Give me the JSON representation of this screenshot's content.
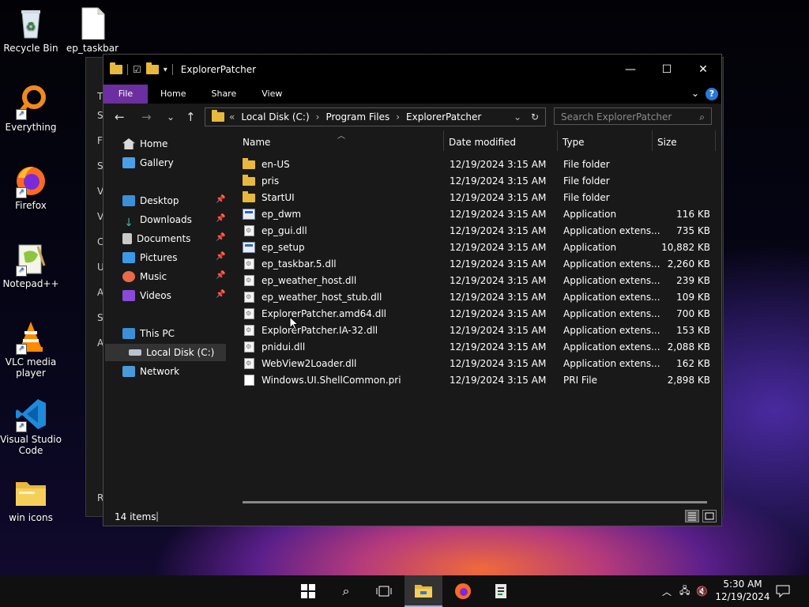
{
  "desktop": {
    "icons": [
      {
        "label": "Recycle Bin"
      },
      {
        "label": "ep_taskbar"
      },
      {
        "label": "Everything"
      },
      {
        "label": "Firefox"
      },
      {
        "label": "Notepad++"
      },
      {
        "label": "VLC media player"
      },
      {
        "label": "Visual Studio Code"
      },
      {
        "label": "win icons"
      }
    ]
  },
  "ghost_letters": [
    "T",
    "S",
    "F",
    "S",
    "V",
    "V",
    "C",
    "U",
    "A",
    "S",
    "A",
    "R"
  ],
  "window": {
    "title": "ExplorerPatcher",
    "ribbon_tabs": [
      "File",
      "Home",
      "Share",
      "View"
    ],
    "address": {
      "overflow": "«",
      "crumbs": [
        "Local Disk (C:)",
        "Program Files",
        "ExplorerPatcher"
      ]
    },
    "search_placeholder": "Search ExplorerPatcher",
    "nav": {
      "home": "Home",
      "gallery": "Gallery",
      "desktop": "Desktop",
      "downloads": "Downloads",
      "documents": "Documents",
      "pictures": "Pictures",
      "music": "Music",
      "videos": "Videos",
      "this_pc": "This PC",
      "local_disk": "Local Disk (C:)",
      "network": "Network"
    },
    "columns": {
      "name": "Name",
      "date": "Date modified",
      "type": "Type",
      "size": "Size"
    },
    "files": [
      {
        "name": "en-US",
        "date": "12/19/2024 3:15 AM",
        "type": "File folder",
        "size": "",
        "kind": "folder"
      },
      {
        "name": "pris",
        "date": "12/19/2024 3:15 AM",
        "type": "File folder",
        "size": "",
        "kind": "folder"
      },
      {
        "name": "StartUI",
        "date": "12/19/2024 3:15 AM",
        "type": "File folder",
        "size": "",
        "kind": "folder"
      },
      {
        "name": "ep_dwm",
        "date": "12/19/2024 3:15 AM",
        "type": "Application",
        "size": "116 KB",
        "kind": "app"
      },
      {
        "name": "ep_gui.dll",
        "date": "12/19/2024 3:15 AM",
        "type": "Application extens...",
        "size": "735 KB",
        "kind": "dll"
      },
      {
        "name": "ep_setup",
        "date": "12/19/2024 3:15 AM",
        "type": "Application",
        "size": "10,882 KB",
        "kind": "app"
      },
      {
        "name": "ep_taskbar.5.dll",
        "date": "12/19/2024 3:15 AM",
        "type": "Application extens...",
        "size": "2,260 KB",
        "kind": "dll"
      },
      {
        "name": "ep_weather_host.dll",
        "date": "12/19/2024 3:15 AM",
        "type": "Application extens...",
        "size": "239 KB",
        "kind": "dll"
      },
      {
        "name": "ep_weather_host_stub.dll",
        "date": "12/19/2024 3:15 AM",
        "type": "Application extens...",
        "size": "109 KB",
        "kind": "dll"
      },
      {
        "name": "ExplorerPatcher.amd64.dll",
        "date": "12/19/2024 3:15 AM",
        "type": "Application extens...",
        "size": "700 KB",
        "kind": "dll"
      },
      {
        "name": "ExplorerPatcher.IA-32.dll",
        "date": "12/19/2024 3:15 AM",
        "type": "Application extens...",
        "size": "153 KB",
        "kind": "dll"
      },
      {
        "name": "pnidui.dll",
        "date": "12/19/2024 3:15 AM",
        "type": "Application extens...",
        "size": "2,088 KB",
        "kind": "dll"
      },
      {
        "name": "WebView2Loader.dll",
        "date": "12/19/2024 3:15 AM",
        "type": "Application extens...",
        "size": "162 KB",
        "kind": "dll"
      },
      {
        "name": "Windows.UI.ShellCommon.pri",
        "date": "12/19/2024 3:15 AM",
        "type": "PRI File",
        "size": "2,898 KB",
        "kind": "pri"
      }
    ],
    "status": "14 items"
  },
  "taskbar": {
    "time": "5:30 AM",
    "date": "12/19/2024"
  }
}
